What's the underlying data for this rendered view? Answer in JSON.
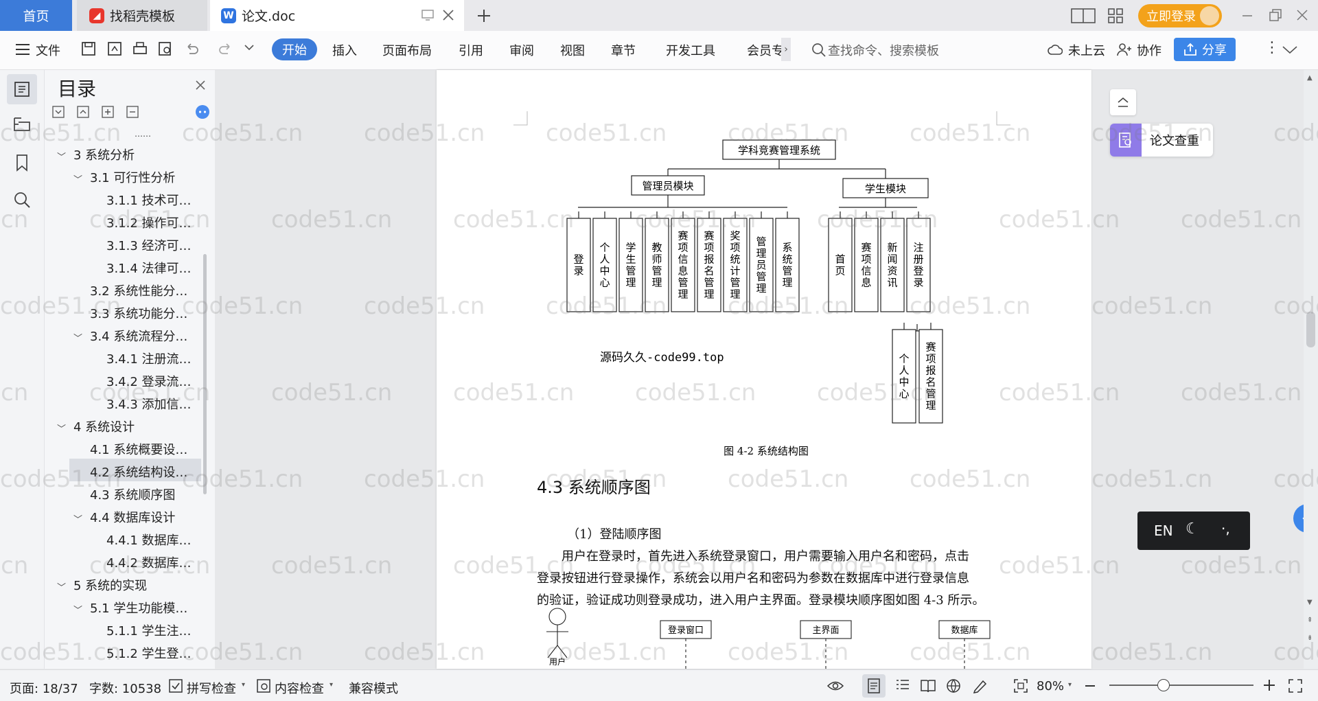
{
  "tabs": {
    "home": "首页",
    "docer": "找稻壳模板",
    "doc": "论文.doc"
  },
  "titlebar": {
    "login": "立即登录"
  },
  "ribbon": {
    "file": "文件",
    "menus": [
      "开始",
      "插入",
      "页面布局",
      "引用",
      "审阅",
      "视图",
      "章节",
      "开发工具",
      "会员专"
    ],
    "search_placeholder": "查找命令、搜索模板",
    "cloud": "未上云",
    "collab": "协作",
    "share": "分享"
  },
  "toc": {
    "title": "目录",
    "items": [
      {
        "label": "3  系统分析"
      },
      {
        "label": "3.1 可行性分析"
      },
      {
        "label": "3.1.1 技术可…"
      },
      {
        "label": "3.1.2 操作可…"
      },
      {
        "label": "3.1.3 经济可…"
      },
      {
        "label": "3.1.4 法律可…"
      },
      {
        "label": "3.2 系统性能分…"
      },
      {
        "label": "3.3 系统功能分…"
      },
      {
        "label": "3.4 系统流程分…"
      },
      {
        "label": "3.4.1 注册流…"
      },
      {
        "label": "3.4.2 登录流…"
      },
      {
        "label": "3.4.3 添加信…"
      },
      {
        "label": "4  系统设计"
      },
      {
        "label": "4.1 系统概要设…"
      },
      {
        "label": "4.2 系统结构设…"
      },
      {
        "label": "4.3  系统顺序图"
      },
      {
        "label": "4.4 数据库设计"
      },
      {
        "label": "4.4.1  数据库…"
      },
      {
        "label": "4.4.2  数据库…"
      },
      {
        "label": "5  系统的实现"
      },
      {
        "label": "5.1 学生功能模…"
      },
      {
        "label": "5.1.1  学生注…"
      },
      {
        "label": "5.1.2  学生登…"
      }
    ]
  },
  "figure": {
    "root": "学科竞赛管理系统",
    "admin": "管理员模块",
    "student": "学生模块",
    "admin_leaves": [
      "登录",
      "个人中心",
      "学生管理",
      "教师管理",
      "赛项信息管理",
      "赛项报名管理",
      "奖项统计管理",
      "管理员管理",
      "系统管理"
    ],
    "student_leaves": [
      "首页",
      "赛项信息",
      "新闻资讯",
      "注册登录"
    ],
    "sub_leaves": [
      "个人中心",
      "赛项报名管理"
    ],
    "source_note": "源码久久-code99.top",
    "caption": "图 4-2 系统结构图"
  },
  "doc": {
    "heading": "4.3  系统顺序图",
    "sub": "（1）登陆顺序图",
    "para_lines": [
      "用户在登录时，首先进入系统登录窗口，用户需要输入用户名和密码，点击",
      "登录按钮进行登录操作，系统会以用户名和密码为参数在数据库中进行登录信息",
      "的验证，验证成功则登录成功，进入用户主界面。登录模块顺序图如图 4-3 所示。"
    ],
    "seq": {
      "actor": "用户",
      "boxes": [
        "登录窗口",
        "主界面",
        "数据库"
      ]
    }
  },
  "right": {
    "check": "论文查重",
    "ime": "EN"
  },
  "status": {
    "page": "页面: 18/37",
    "words": "字数: 10538",
    "spell": "拼写检查",
    "content": "内容检查",
    "compat": "兼容模式",
    "zoom": "80%"
  },
  "watermark": "code51.cn"
}
